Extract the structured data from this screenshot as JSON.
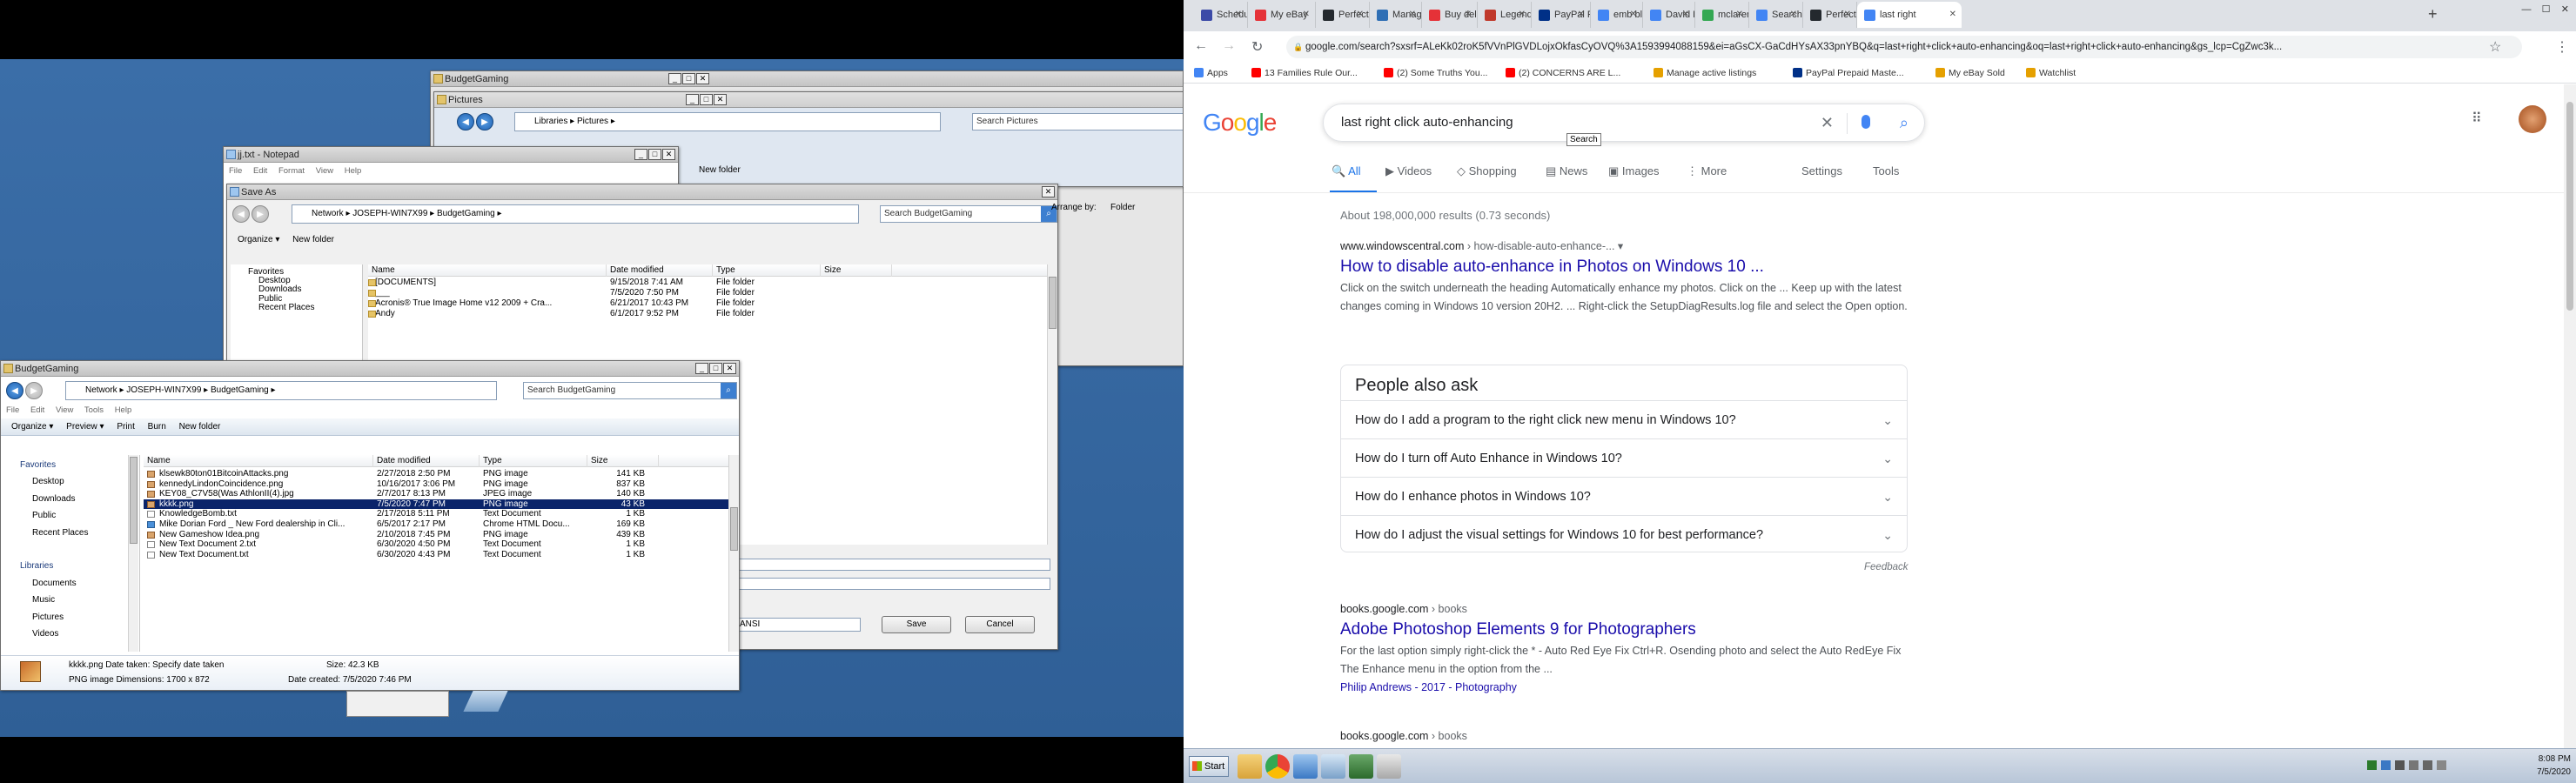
{
  "left": {
    "win_budget_back": {
      "title": "BudgetGaming"
    },
    "win_pictures": {
      "title": "Pictures",
      "breadcrumb": [
        "Libraries",
        "Pictures"
      ],
      "search_placeholder": "Search Pictures",
      "new_folder": "New folder"
    },
    "win_notepad": {
      "title": "jj.txt - Notepad",
      "menu": [
        "File",
        "Edit",
        "Format",
        "View",
        "Help"
      ]
    },
    "save_as": {
      "title": "Save As",
      "breadcrumb": [
        "Network",
        "JOSEPH-WIN7X99",
        "BudgetGaming"
      ],
      "search_placeholder": "Search BudgetGaming",
      "organize": "Organize",
      "new_folder": "New folder",
      "arrange_by": "Arrange by:",
      "arrange_value": "Folder",
      "favorites": [
        "Favorites",
        "Desktop",
        "Downloads",
        "Public",
        "Recent Places"
      ],
      "columns": [
        "Name",
        "Date modified",
        "Type",
        "Size"
      ],
      "rows": [
        {
          "name": "[DOCUMENTS]",
          "date": "9/15/2018 7:41 AM",
          "type": "File folder"
        },
        {
          "name": "___",
          "date": "7/5/2020 7:50 PM",
          "type": "File folder"
        },
        {
          "name": "Acronis® True Image Home v12 2009 + Cra...",
          "date": "6/21/2017 10:43 PM",
          "type": "File folder"
        },
        {
          "name": "Andy",
          "date": "6/1/2017 9:52 PM",
          "type": "File folder"
        }
      ],
      "encoding_value": "ANSI",
      "save": "Save",
      "cancel": "Cancel"
    },
    "explorer": {
      "title": "BudgetGaming",
      "breadcrumb": [
        "Network",
        "JOSEPH-WIN7X99",
        "BudgetGaming"
      ],
      "search_placeholder": "Search BudgetGaming",
      "menu": [
        "File",
        "Edit",
        "View",
        "Tools",
        "Help"
      ],
      "toolbar": [
        "Organize",
        "Preview",
        "Print",
        "Burn",
        "New folder"
      ],
      "nav": [
        "Favorites",
        "Desktop",
        "Downloads",
        "Public",
        "Recent Places",
        "",
        "Libraries",
        "Documents",
        "Music",
        "Pictures",
        "Videos"
      ],
      "columns": [
        "Name",
        "Date modified",
        "Type",
        "Size"
      ],
      "rows": [
        {
          "name": "klsewk80ton01BitcoinAttacks.png",
          "date": "2/27/2018 2:50 PM",
          "type": "PNG image",
          "size": "141 KB"
        },
        {
          "name": "kennedyLindonCoincidence.png",
          "date": "10/16/2017 3:06 PM",
          "type": "PNG image",
          "size": "837 KB"
        },
        {
          "name": "KEY08_C7V58(Was AthlonII(4).jpg",
          "date": "2/7/2017 8:13 PM",
          "type": "JPEG image",
          "size": "140 KB"
        },
        {
          "name": "kkkk.png",
          "date": "7/5/2020 7:47 PM",
          "type": "PNG image",
          "size": "43 KB"
        },
        {
          "name": "KnowledgeBomb.txt",
          "date": "2/17/2018 5:11 PM",
          "type": "Text Document",
          "size": "1 KB"
        },
        {
          "name": "Mike Dorian Ford _ New Ford dealership in Cli...",
          "date": "6/5/2017 2:17 PM",
          "type": "Chrome HTML Docu...",
          "size": "169 KB"
        },
        {
          "name": "New Gameshow Idea.png",
          "date": "2/10/2018 7:45 PM",
          "type": "PNG image",
          "size": "439 KB"
        },
        {
          "name": "New Text Document 2.txt",
          "date": "6/30/2020 4:50 PM",
          "type": "Text Document",
          "size": "1 KB"
        },
        {
          "name": "New Text Document.txt",
          "date": "6/30/2020 4:43 PM",
          "type": "Text Document",
          "size": "1 KB"
        }
      ],
      "details": {
        "line1": "kkkk.png  Date taken: Specify date taken",
        "line2": "PNG image  Dimensions: 1700 x 872",
        "size": "Size: 42.3 KB",
        "created": "Date created: 7/5/2020 7:46 PM"
      }
    }
  },
  "chrome": {
    "tabs": [
      "Schedule",
      "My eBay",
      "PerfectP",
      "Manage",
      "Buy delive",
      "Legends",
      "PayPal Pr",
      "emb blo",
      "David R",
      "mclaren",
      "Search f",
      "PerfectP",
      "last right"
    ],
    "tab_colors": [
      "#3c4aa7",
      "#e53238",
      "#24292e",
      "#2f6fb5",
      "#e53238",
      "#c0392b",
      "#003087",
      "#4285f4",
      "#4285f4",
      "#34a853",
      "#4285f4",
      "#24292e",
      "#4285f4"
    ],
    "url": "google.com/search?sxsrf=ALeKk02roK5fVVnPlGVDLojxOkfasCyOVQ%3A1593994088159&ei=aGsCX-GaCdHYsAX33pnYBQ&q=last+right+click+auto-enhancing&oq=last+right+click+auto-enhancing&gs_lcp=CgZwc3k...",
    "bookmarks": [
      "Apps",
      "13 Families Rule Our...",
      "(2) Some Truths You...",
      "(2) CONCERNS ARE L...",
      "Manage active listings",
      "PayPal Prepaid Maste...",
      "My eBay Sold",
      "Watchlist"
    ],
    "bookmark_colors": [
      "#4285f4",
      "#ff0000",
      "#ff0000",
      "#ff0000",
      "#e5a000",
      "#003087",
      "#e5a000",
      "#e5a000"
    ]
  },
  "google": {
    "logo": "Google",
    "query": "last right click auto-enhancing",
    "tooltip": "Search",
    "tabs": [
      "All",
      "Videos",
      "Shopping",
      "News",
      "Images",
      "More",
      "Settings",
      "Tools"
    ],
    "stats": "About 198,000,000 results (0.73 seconds)",
    "result1": {
      "cite_domain": "www.windowscentral.com",
      "cite_path": " › how-disable-auto-enhance-... ▾",
      "title": "How to disable auto-enhance in Photos on Windows 10 ...",
      "snippet": "Click on the switch underneath the heading Automatically enhance my photos. Click on the ... Keep up with the latest changes coming in Windows 10 version 20H2. ... Right-click the SetupDiagResults.log file and select the Open option."
    },
    "paa": {
      "title": "People also ask",
      "questions": [
        "How do I add a program to the right click new menu in Windows 10?",
        "How do I turn off Auto Enhance in Windows 10?",
        "How do I enhance photos in Windows 10?",
        "How do I adjust the visual settings for Windows 10 for best performance?"
      ],
      "feedback": "Feedback"
    },
    "result2": {
      "cite_domain": "books.google.com",
      "cite_path": " › books",
      "title": "Adobe Photoshop Elements 9 for Photographers",
      "snippet": "For the last option simply right-click the * - Auto Red Eye Fix Ctrl+R. Osending photo and select the Auto RedEye Fix The Enhance menu in the option from the ...",
      "byline": "Philip Andrews - 2017 - Photography"
    },
    "result3": {
      "cite_domain": "books.google.com",
      "cite_path": " › books"
    }
  },
  "taskbar": {
    "start": "Start",
    "time": "8:08 PM",
    "date": "7/5/2020"
  }
}
